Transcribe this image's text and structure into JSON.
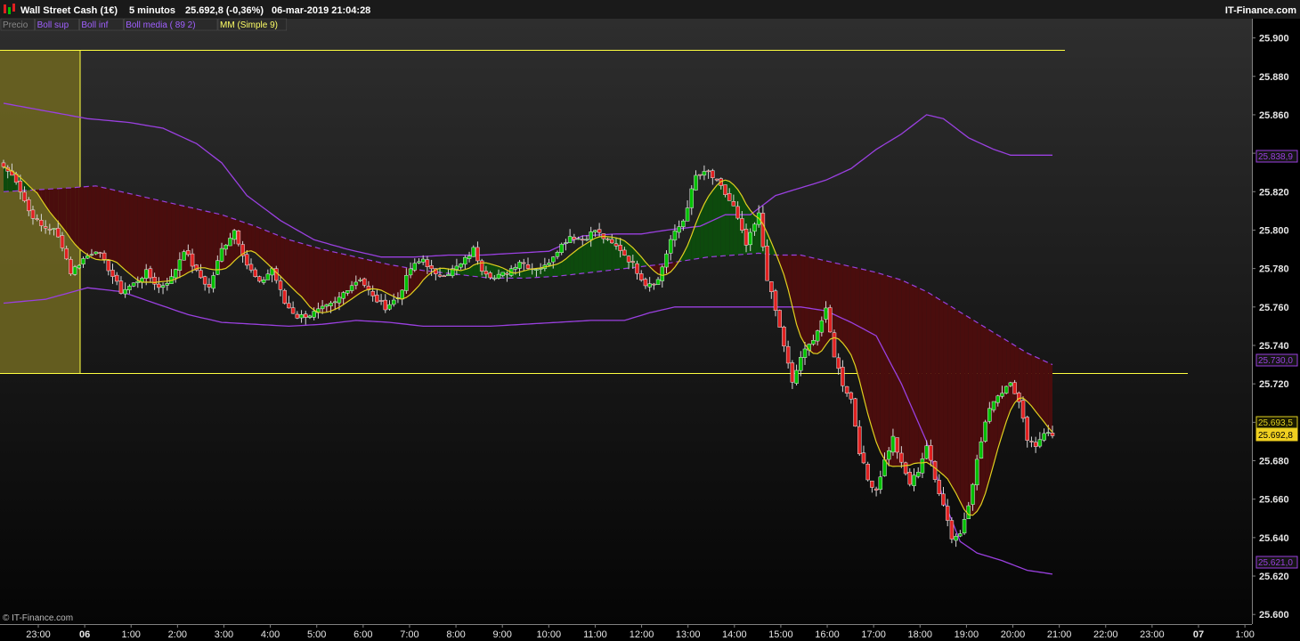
{
  "header": {
    "instrument": "Wall Street Cash (1€)",
    "timeframe": "5 minutos",
    "last_change": "25.692,8 (-0,36%)",
    "datetime": "06-mar-2019 21:04:28",
    "brand": "IT-Finance.com"
  },
  "legend": [
    {
      "label": "Precio",
      "color": "#888888"
    },
    {
      "label": "Boll sup",
      "color": "#a060ff"
    },
    {
      "label": "Boll inf",
      "color": "#a060ff"
    },
    {
      "label": "Boll media ( 89 2)",
      "color": "#a060ff"
    },
    {
      "label": "MM (Simple 9)",
      "color": "#ffff66"
    }
  ],
  "copyright": "© IT-Finance.com",
  "colors": {
    "background": "#000000",
    "candle_up": "#00c000",
    "candle_down": "#e02020",
    "bollinger": "#9a40e0",
    "sma": "#e0d020",
    "fill_above": "#0d4a0d",
    "fill_below": "#4a0d0d",
    "zone": "#6b6420",
    "zone_line": "#ffff40"
  },
  "price_tags": [
    {
      "label": "25.838,9",
      "type": "boll_sup"
    },
    {
      "label": "25.730,0",
      "type": "boll_media"
    },
    {
      "label": "25.693,5",
      "type": "sma"
    },
    {
      "label": "25.692,8",
      "type": "last"
    },
    {
      "label": "25.621,0",
      "type": "boll_inf"
    }
  ],
  "chart_data": {
    "type": "candlestick",
    "ylim": [
      25595,
      25910
    ],
    "y_ticks": [
      "25.900",
      "25.880",
      "25.860",
      "25.840",
      "25.820",
      "25.800",
      "25.780",
      "25.760",
      "25.740",
      "25.720",
      "25.700",
      "25.680",
      "25.660",
      "25.640",
      "25.620",
      "25.600"
    ],
    "x_ticks": [
      {
        "label": "23:00",
        "bold": false
      },
      {
        "label": "06",
        "bold": true
      },
      {
        "label": "1:00",
        "bold": false
      },
      {
        "label": "2:00",
        "bold": false
      },
      {
        "label": "3:00",
        "bold": false
      },
      {
        "label": "4:00",
        "bold": false
      },
      {
        "label": "5:00",
        "bold": false
      },
      {
        "label": "6:00",
        "bold": false
      },
      {
        "label": "7:00",
        "bold": false
      },
      {
        "label": "8:00",
        "bold": false
      },
      {
        "label": "9:00",
        "bold": false
      },
      {
        "label": "10:00",
        "bold": false
      },
      {
        "label": "11:00",
        "bold": false
      },
      {
        "label": "12:00",
        "bold": false
      },
      {
        "label": "13:00",
        "bold": false
      },
      {
        "label": "14:00",
        "bold": false
      },
      {
        "label": "15:00",
        "bold": false
      },
      {
        "label": "16:00",
        "bold": false
      },
      {
        "label": "17:00",
        "bold": false
      },
      {
        "label": "18:00",
        "bold": false
      },
      {
        "label": "19:00",
        "bold": false
      },
      {
        "label": "20:00",
        "bold": false
      },
      {
        "label": "21:00",
        "bold": false
      },
      {
        "label": "22:00",
        "bold": false
      },
      {
        "label": "23:00",
        "bold": false
      },
      {
        "label": "07",
        "bold": true
      },
      {
        "label": "1:00",
        "bold": false
      }
    ],
    "price_keypoints": [
      [
        0,
        25833
      ],
      [
        3,
        25826
      ],
      [
        6,
        25810
      ],
      [
        9,
        25802
      ],
      [
        12,
        25800
      ],
      [
        14,
        25792
      ],
      [
        16,
        25778
      ],
      [
        19,
        25785
      ],
      [
        22,
        25790
      ],
      [
        25,
        25780
      ],
      [
        28,
        25768
      ],
      [
        31,
        25772
      ],
      [
        34,
        25778
      ],
      [
        37,
        25770
      ],
      [
        40,
        25775
      ],
      [
        43,
        25790
      ],
      [
        46,
        25778
      ],
      [
        49,
        25770
      ],
      [
        52,
        25790
      ],
      [
        55,
        25800
      ],
      [
        58,
        25782
      ],
      [
        61,
        25772
      ],
      [
        64,
        25780
      ],
      [
        67,
        25762
      ],
      [
        70,
        25755
      ],
      [
        73,
        25756
      ],
      [
        76,
        25759
      ],
      [
        79,
        25762
      ],
      [
        82,
        25770
      ],
      [
        85,
        25775
      ],
      [
        88,
        25765
      ],
      [
        91,
        25760
      ],
      [
        94,
        25765
      ],
      [
        97,
        25780
      ],
      [
        100,
        25785
      ],
      [
        103,
        25776
      ],
      [
        106,
        25778
      ],
      [
        109,
        25782
      ],
      [
        112,
        25790
      ],
      [
        114,
        25780
      ],
      [
        117,
        25775
      ],
      [
        120,
        25778
      ],
      [
        123,
        25784
      ],
      [
        126,
        25780
      ],
      [
        129,
        25781
      ],
      [
        132,
        25790
      ],
      [
        135,
        25797
      ],
      [
        138,
        25795
      ],
      [
        141,
        25800
      ],
      [
        144,
        25794
      ],
      [
        147,
        25790
      ],
      [
        150,
        25782
      ],
      [
        153,
        25772
      ],
      [
        156,
        25774
      ],
      [
        159,
        25795
      ],
      [
        162,
        25805
      ],
      [
        165,
        25828
      ],
      [
        168,
        25830
      ],
      [
        171,
        25822
      ],
      [
        174,
        25812
      ],
      [
        177,
        25792
      ],
      [
        180,
        25808
      ],
      [
        182,
        25775
      ],
      [
        184,
        25758
      ],
      [
        186,
        25740
      ],
      [
        188,
        25720
      ],
      [
        190,
        25734
      ],
      [
        192,
        25740
      ],
      [
        194,
        25748
      ],
      [
        196,
        25758
      ],
      [
        198,
        25735
      ],
      [
        200,
        25720
      ],
      [
        202,
        25712
      ],
      [
        204,
        25685
      ],
      [
        206,
        25670
      ],
      [
        208,
        25665
      ],
      [
        210,
        25680
      ],
      [
        212,
        25692
      ],
      [
        214,
        25678
      ],
      [
        216,
        25668
      ],
      [
        218,
        25675
      ],
      [
        220,
        25688
      ],
      [
        222,
        25670
      ],
      [
        224,
        25658
      ],
      [
        226,
        25640
      ],
      [
        228,
        25642
      ],
      [
        230,
        25658
      ],
      [
        232,
        25680
      ],
      [
        234,
        25700
      ],
      [
        236,
        25712
      ],
      [
        238,
        25716
      ],
      [
        240,
        25722
      ],
      [
        242,
        25710
      ],
      [
        244,
        25692
      ],
      [
        246,
        25688
      ],
      [
        248,
        25695
      ],
      [
        250,
        25693
      ]
    ],
    "bollinger_upper_keypoints": [
      [
        0,
        25866
      ],
      [
        10,
        25862
      ],
      [
        20,
        25858
      ],
      [
        30,
        25856
      ],
      [
        38,
        25853
      ],
      [
        46,
        25845
      ],
      [
        52,
        25835
      ],
      [
        58,
        25818
      ],
      [
        66,
        25805
      ],
      [
        74,
        25795
      ],
      [
        82,
        25790
      ],
      [
        90,
        25786
      ],
      [
        98,
        25786
      ],
      [
        106,
        25787
      ],
      [
        114,
        25787
      ],
      [
        122,
        25788
      ],
      [
        130,
        25789
      ],
      [
        138,
        25797
      ],
      [
        146,
        25798
      ],
      [
        152,
        25798
      ],
      [
        158,
        25800
      ],
      [
        166,
        25802
      ],
      [
        172,
        25808
      ],
      [
        178,
        25808
      ],
      [
        184,
        25818
      ],
      [
        190,
        25822
      ],
      [
        196,
        25826
      ],
      [
        202,
        25832
      ],
      [
        208,
        25842
      ],
      [
        214,
        25850
      ],
      [
        220,
        25860
      ],
      [
        224,
        25858
      ],
      [
        230,
        25848
      ],
      [
        236,
        25842
      ],
      [
        240,
        25839
      ],
      [
        250,
        25839
      ]
    ],
    "bollinger_lower_keypoints": [
      [
        0,
        25762
      ],
      [
        10,
        25764
      ],
      [
        20,
        25770
      ],
      [
        28,
        25768
      ],
      [
        36,
        25762
      ],
      [
        44,
        25756
      ],
      [
        52,
        25752
      ],
      [
        60,
        25751
      ],
      [
        68,
        25750
      ],
      [
        76,
        25751
      ],
      [
        84,
        25753
      ],
      [
        92,
        25752
      ],
      [
        100,
        25750
      ],
      [
        108,
        25750
      ],
      [
        116,
        25750
      ],
      [
        124,
        25751
      ],
      [
        132,
        25752
      ],
      [
        140,
        25753
      ],
      [
        148,
        25753
      ],
      [
        154,
        25757
      ],
      [
        160,
        25760
      ],
      [
        166,
        25760
      ],
      [
        172,
        25760
      ],
      [
        180,
        25760
      ],
      [
        184,
        25760
      ],
      [
        190,
        25760
      ],
      [
        196,
        25758
      ],
      [
        202,
        25752
      ],
      [
        208,
        25745
      ],
      [
        214,
        25720
      ],
      [
        220,
        25690
      ],
      [
        224,
        25660
      ],
      [
        228,
        25638
      ],
      [
        232,
        25632
      ],
      [
        238,
        25628
      ],
      [
        244,
        25623
      ],
      [
        250,
        25621
      ]
    ],
    "bollinger_mid_keypoints": [
      [
        0,
        25820
      ],
      [
        8,
        25821
      ],
      [
        16,
        25822
      ],
      [
        22,
        25823
      ],
      [
        28,
        25820
      ],
      [
        36,
        25816
      ],
      [
        44,
        25812
      ],
      [
        52,
        25808
      ],
      [
        60,
        25802
      ],
      [
        68,
        25795
      ],
      [
        76,
        25790
      ],
      [
        84,
        25786
      ],
      [
        92,
        25782
      ],
      [
        100,
        25779
      ],
      [
        108,
        25777
      ],
      [
        116,
        25775
      ],
      [
        124,
        25775
      ],
      [
        132,
        25776
      ],
      [
        140,
        25778
      ],
      [
        148,
        25780
      ],
      [
        156,
        25782
      ],
      [
        162,
        25784
      ],
      [
        168,
        25786
      ],
      [
        174,
        25787
      ],
      [
        180,
        25788
      ],
      [
        184,
        25787
      ],
      [
        190,
        25787
      ],
      [
        196,
        25784
      ],
      [
        202,
        25781
      ],
      [
        208,
        25778
      ],
      [
        214,
        25774
      ],
      [
        220,
        25768
      ],
      [
        226,
        25760
      ],
      [
        232,
        25752
      ],
      [
        238,
        25744
      ],
      [
        244,
        25736
      ],
      [
        250,
        25730
      ]
    ]
  }
}
